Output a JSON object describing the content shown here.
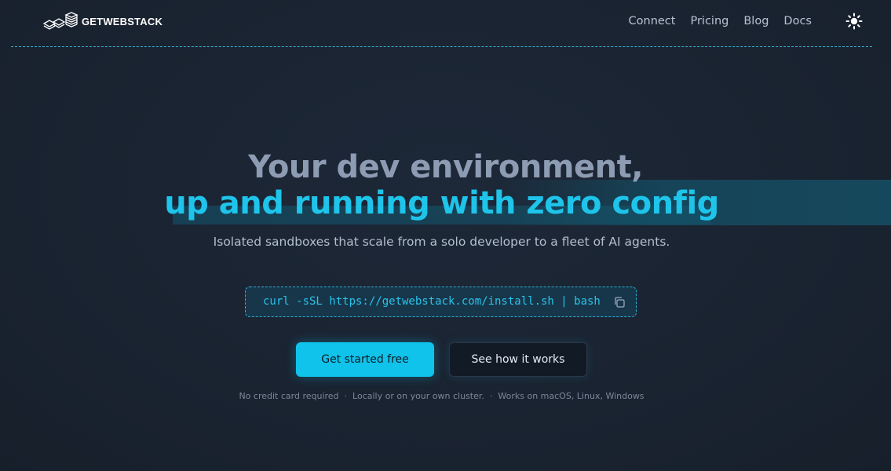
{
  "header": {
    "logo_text": "GETWEBSTACK",
    "nav": [
      {
        "label": "Connect"
      },
      {
        "label": "Pricing"
      },
      {
        "label": "Blog"
      },
      {
        "label": "Docs"
      }
    ],
    "theme_toggle_icon": "sun-icon"
  },
  "hero": {
    "title_line1": "Your dev environment,",
    "title_line2": "up and running with zero config",
    "subtitle": "Isolated sandboxes that scale from a solo developer to a fleet of AI agents.",
    "install_command": "curl -sSL https://getwebstack.com/install.sh | bash",
    "copy_icon": "copy-icon",
    "primary_button": "Get started free",
    "secondary_button": "See how it works",
    "footnotes": [
      "No credit card required",
      "Locally or on your own cluster.",
      "Works on macOS, Linux, Windows"
    ],
    "footnote_separator": "·"
  },
  "colors": {
    "background": "#1a2332",
    "accent": "#1ec4ea",
    "primary_button": "#0fc3ea"
  }
}
